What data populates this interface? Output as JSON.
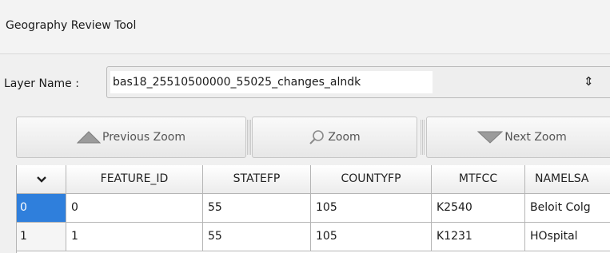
{
  "window": {
    "title": "Geography Review Tool"
  },
  "layer": {
    "label": "Layer Name :",
    "value": "bas18_25510500000_55025_changes_alndk"
  },
  "toolbar": {
    "previous_zoom": "Previous Zoom",
    "zoom": "Zoom",
    "next_zoom": "Next Zoom"
  },
  "table": {
    "columns": [
      "FEATURE_ID",
      "STATEFP",
      "COUNTYFP",
      "MTFCC",
      "NAMELSA"
    ],
    "rows": [
      {
        "num": "0",
        "cells": [
          "0",
          "55",
          "105",
          "K2540",
          "Beloit Colg"
        ]
      },
      {
        "num": "1",
        "cells": [
          "1",
          "55",
          "105",
          "K1231",
          "HOspital"
        ]
      }
    ],
    "selected_row_color": "#2f7fdc"
  }
}
